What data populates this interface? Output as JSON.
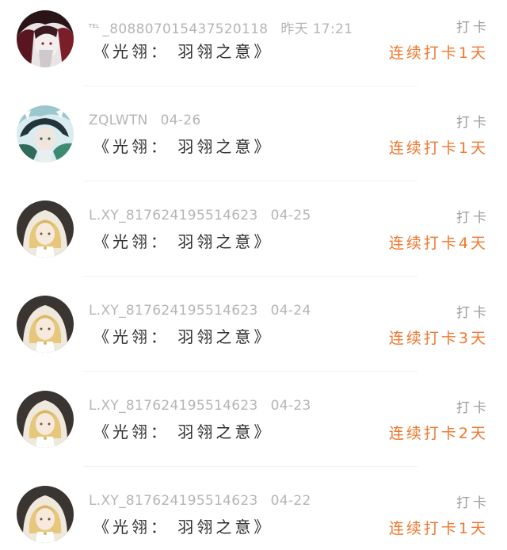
{
  "checkins": [
    {
      "tel_label": "TEL",
      "username": "_808807015437520118",
      "date": "昨天 17:21",
      "work": "《光翎： 羽翎之意》",
      "action": "打卡",
      "streak": "连续打卡1天",
      "avatar_icon": "dark-red-hair-avatar-icon"
    },
    {
      "tel_label": "",
      "username": "ZQLWTN",
      "date": "04-26",
      "work": "《光翎： 羽翎之意》",
      "action": "打卡",
      "streak": "连续打卡1天",
      "avatar_icon": "green-teal-character-avatar-icon"
    },
    {
      "tel_label": "",
      "username": "L.XY_817624195514623",
      "date": "04-25",
      "work": "《光翎： 羽翎之意》",
      "action": "打卡",
      "streak": "连续打卡4天",
      "avatar_icon": "blonde-hooded-character-avatar-icon"
    },
    {
      "tel_label": "",
      "username": "L.XY_817624195514623",
      "date": "04-24",
      "work": "《光翎： 羽翎之意》",
      "action": "打卡",
      "streak": "连续打卡3天",
      "avatar_icon": "blonde-hooded-character-avatar-icon"
    },
    {
      "tel_label": "",
      "username": "L.XY_817624195514623",
      "date": "04-23",
      "work": "《光翎： 羽翎之意》",
      "action": "打卡",
      "streak": "连续打卡2天",
      "avatar_icon": "blonde-hooded-character-avatar-icon"
    },
    {
      "tel_label": "",
      "username": "L.XY_817624195514623",
      "date": "04-22",
      "work": "《光翎： 羽翎之意》",
      "action": "打卡",
      "streak": "连续打卡1天",
      "avatar_icon": "blonde-hooded-character-avatar-icon"
    }
  ],
  "colors": {
    "streak": "#f2762d",
    "meta": "#b5b5b5",
    "title": "#2d2d2d",
    "action": "#9b9b9b"
  }
}
